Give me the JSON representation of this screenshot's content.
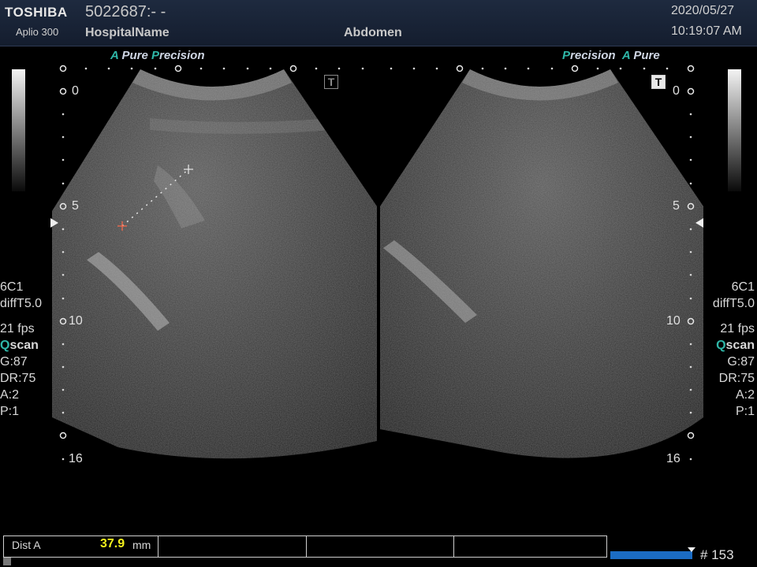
{
  "header": {
    "brand": "TOSHIBA",
    "model": "Aplio 300",
    "patient_id": "5022687:- -",
    "hospital": "HospitalName",
    "preset": "Abdomen",
    "date": "2020/05/27",
    "time": "10:19:07 AM"
  },
  "left_panel": {
    "mode_label": {
      "a": "A",
      "pure": " Pure",
      "p": "P",
      "precision": "recision"
    },
    "depth_labels": [
      "0",
      "5",
      "10",
      "16"
    ],
    "t_icon": "T",
    "params": {
      "probe": "6C1",
      "harmonic": "diffT5.0",
      "fps": "21 fps",
      "qscan_q": "Q",
      "qscan_rest": "scan",
      "gain": "G:87",
      "dr": "DR:75",
      "a": "A:2",
      "p": "P:1"
    }
  },
  "right_panel": {
    "mode_label": {
      "p": "P",
      "precision": "recision",
      "a": "A",
      "pure": " Pure"
    },
    "depth_labels": [
      "0",
      "5",
      "10",
      "16"
    ],
    "t_icon": "T",
    "params": {
      "probe": "6C1",
      "harmonic": "diffT5.0",
      "fps": "21 fps",
      "qscan_q": "Q",
      "qscan_rest": "scan",
      "gain": "G:87",
      "dr": "DR:75",
      "a": "A:2",
      "p": "P:1"
    }
  },
  "measurement": {
    "label": "Dist A",
    "value": "37.9",
    "unit": "mm"
  },
  "cine": {
    "frame": "# 153"
  },
  "colors": {
    "header_bg": "#1a2436",
    "accent_teal": "#2fb7a8",
    "measurement_value": "#f4f21c",
    "cine_bar": "#1b6cc4"
  }
}
